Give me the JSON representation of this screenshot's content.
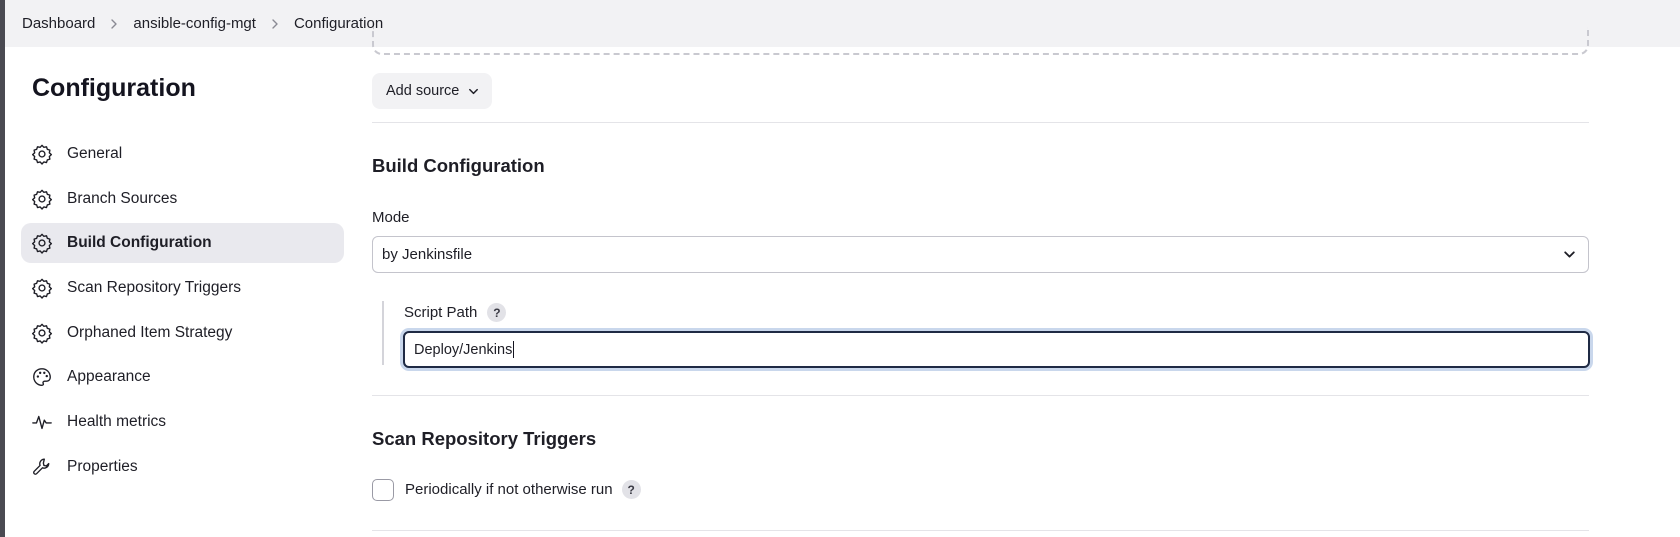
{
  "breadcrumb": {
    "items": [
      "Dashboard",
      "ansible-config-mgt",
      "Configuration"
    ]
  },
  "page_title": "Configuration",
  "sidebar": {
    "items": [
      {
        "label": "General",
        "icon": "gear-icon"
      },
      {
        "label": "Branch Sources",
        "icon": "gear-icon"
      },
      {
        "label": "Build Configuration",
        "icon": "gear-icon",
        "active": true
      },
      {
        "label": "Scan Repository Triggers",
        "icon": "gear-icon"
      },
      {
        "label": "Orphaned Item Strategy",
        "icon": "gear-icon"
      },
      {
        "label": "Appearance",
        "icon": "palette-icon"
      },
      {
        "label": "Health metrics",
        "icon": "pulse-icon"
      },
      {
        "label": "Properties",
        "icon": "wrench-icon"
      }
    ]
  },
  "main": {
    "add_source_label": "Add source",
    "build_config": {
      "title": "Build Configuration",
      "mode_label": "Mode",
      "mode_value": "by Jenkinsfile",
      "script_path_label": "Script Path",
      "script_path_value": "Deploy/Jenkins",
      "help": "?"
    },
    "scan_triggers": {
      "title": "Scan Repository Triggers",
      "periodic_label": "Periodically if not otherwise run",
      "periodic_checked": false,
      "help": "?"
    }
  },
  "colors": {
    "active_bg": "#e9e9ee",
    "focus_border": "#1f2a44",
    "focus_ring": "#c9d7ec"
  }
}
